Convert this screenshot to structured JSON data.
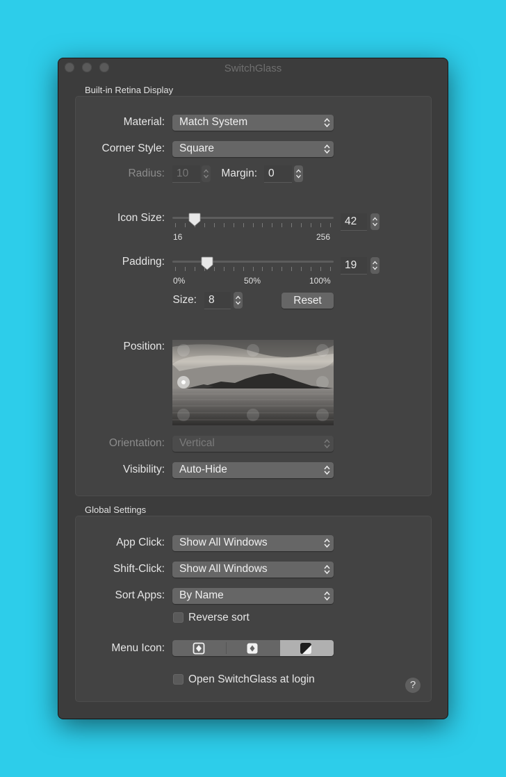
{
  "window": {
    "title": "SwitchGlass"
  },
  "display": {
    "section_title": "Built-in Retina Display",
    "material": {
      "label": "Material:",
      "value": "Match System"
    },
    "corner_style": {
      "label": "Corner Style:",
      "value": "Square"
    },
    "radius": {
      "label": "Radius:",
      "value": "10"
    },
    "margin": {
      "label": "Margin:",
      "value": "0"
    },
    "icon_size": {
      "label": "Icon Size:",
      "value": "42",
      "min_label": "16",
      "max_label": "256",
      "min": 16,
      "max": 256
    },
    "padding": {
      "label": "Padding:",
      "value": "19",
      "tick_labels": [
        "0%",
        "50%",
        "100%"
      ],
      "fraction": 0.2
    },
    "size": {
      "label": "Size:",
      "value": "8"
    },
    "reset_label": "Reset",
    "position": {
      "label": "Position:",
      "selected": "middle-left"
    },
    "orientation": {
      "label": "Orientation:",
      "value": "Vertical"
    },
    "visibility": {
      "label": "Visibility:",
      "value": "Auto-Hide"
    }
  },
  "global": {
    "section_title": "Global Settings",
    "app_click": {
      "label": "App Click:",
      "value": "Show All Windows"
    },
    "shift_click": {
      "label": "Shift-Click:",
      "value": "Show All Windows"
    },
    "sort_apps": {
      "label": "Sort Apps:",
      "value": "By Name"
    },
    "reverse_sort": {
      "label": "Reverse sort",
      "checked": false
    },
    "menu_icon": {
      "label": "Menu Icon:",
      "options": [
        "framed-diamond-icon",
        "diamond-icon",
        "half-square-icon"
      ],
      "selected": 2
    },
    "open_at_login": {
      "label": "Open SwitchGlass at login",
      "checked": false
    },
    "help": "?"
  },
  "colors": {
    "background": "#2dcdea",
    "window": "#3c3c3c",
    "control": "#666666"
  }
}
